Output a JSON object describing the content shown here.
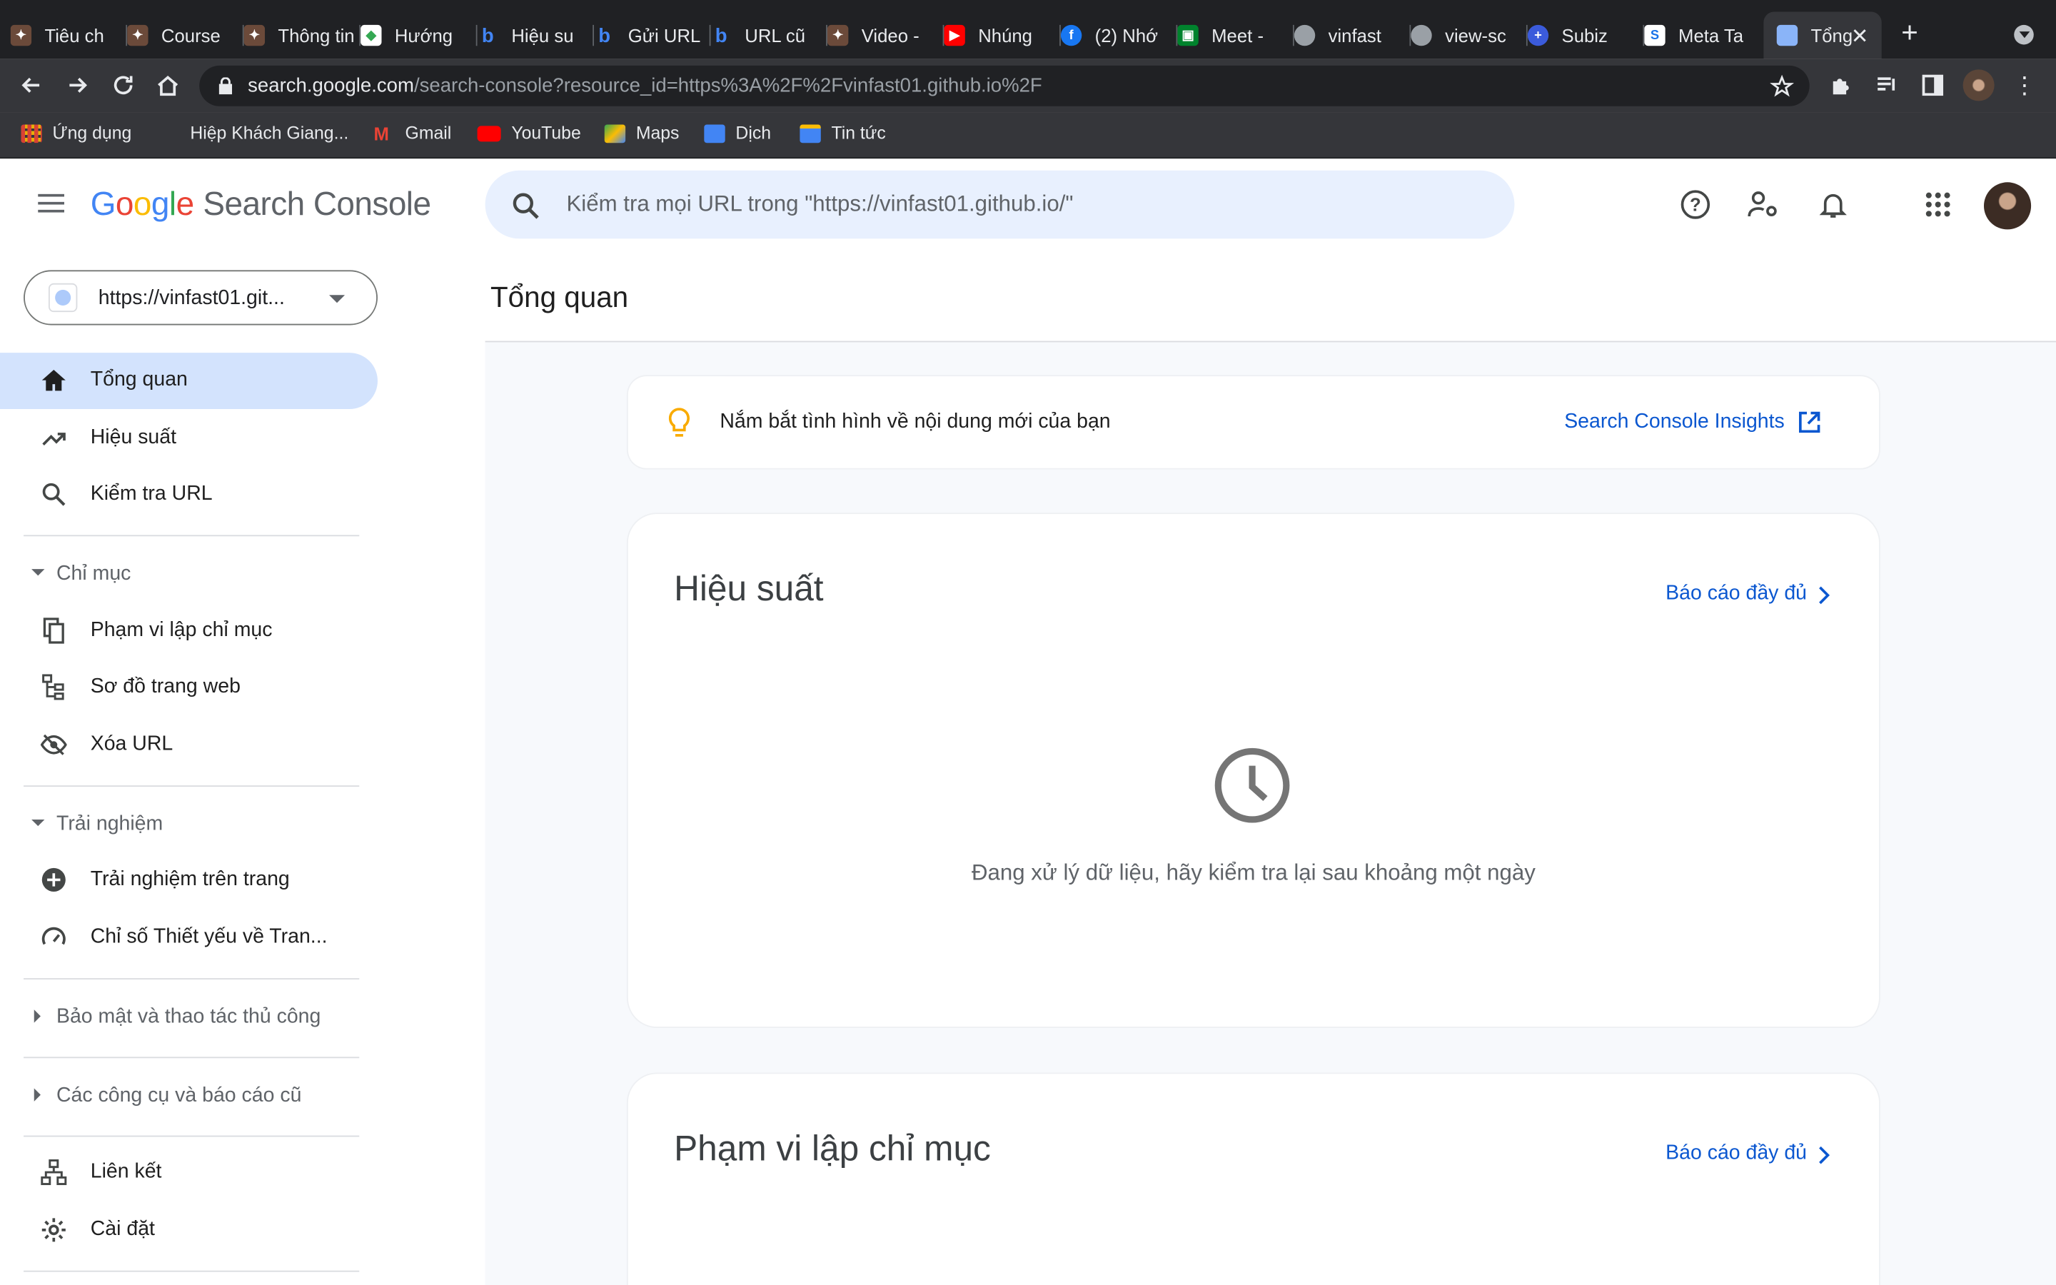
{
  "browser": {
    "tabs": [
      {
        "title": "Tiêu ch",
        "icon": "logo-icon"
      },
      {
        "title": "Course",
        "icon": "logo-icon"
      },
      {
        "title": "Thông tin",
        "icon": "logo-icon"
      },
      {
        "title": "Hướng",
        "icon": "dev-icon"
      },
      {
        "title": "Hiệu su",
        "icon": "bing-icon"
      },
      {
        "title": "Gửi URL",
        "icon": "bing-icon"
      },
      {
        "title": "URL cũ",
        "icon": "bing-icon"
      },
      {
        "title": "Video -",
        "icon": "logo-icon"
      },
      {
        "title": "Nhúng",
        "icon": "youtube-icon"
      },
      {
        "title": "(2) Nhớ",
        "icon": "facebook-icon"
      },
      {
        "title": "Meet -",
        "icon": "meet-icon"
      },
      {
        "title": "vinfast",
        "icon": "globe-icon"
      },
      {
        "title": "view-sc",
        "icon": "globe-icon"
      },
      {
        "title": "Subiz",
        "icon": "subiz-icon"
      },
      {
        "title": "Meta Ta",
        "icon": "meta-icon"
      },
      {
        "title": "Tổng",
        "icon": "search-console-icon"
      }
    ],
    "url_host": "search.google.com",
    "url_path": "/search-console?resource_id=https%3A%2F%2Fvinfast01.github.io%2F",
    "bookmarks": [
      {
        "label": "Ứng dụng",
        "color": "#8ab4f8"
      },
      {
        "label": "Hiệp Khách Giang...",
        "color": ""
      },
      {
        "label": "Gmail",
        "color": "#ea4335"
      },
      {
        "label": "YouTube",
        "color": "#ff0000"
      },
      {
        "label": "Maps",
        "color": "#34a853"
      },
      {
        "label": "Dịch",
        "color": "#4285f4"
      },
      {
        "label": "Tin tức",
        "color": "#4285f4"
      }
    ]
  },
  "app": {
    "logo_google": "Google",
    "logo_product": "Search Console",
    "search_placeholder": "Kiểm tra mọi URL trong \"https://vinfast01.github.io/\"",
    "property": "https://vinfast01.git..."
  },
  "sidebar": {
    "items": [
      {
        "label": "Tổng quan",
        "icon": "home-icon",
        "active": true
      },
      {
        "label": "Hiệu suất",
        "icon": "trending-up-icon"
      },
      {
        "label": "Kiểm tra URL",
        "icon": "search-icon"
      }
    ],
    "index_section": "Chỉ mục",
    "index_items": [
      {
        "label": "Phạm vi lập chỉ mục",
        "icon": "file-copy-icon"
      },
      {
        "label": "Sơ đồ trang web",
        "icon": "sitemap-icon"
      },
      {
        "label": "Xóa URL",
        "icon": "visibility-off-icon"
      }
    ],
    "experience_section": "Trải nghiệm",
    "experience_items": [
      {
        "label": "Trải nghiệm trên trang",
        "icon": "add-circle-icon"
      },
      {
        "label": "Chỉ số Thiết yếu về Tran...",
        "icon": "speed-icon"
      }
    ],
    "security_section": "Bảo mật và thao tác thủ công",
    "legacy_section": "Các công cụ và báo cáo cũ",
    "bottom_items": [
      {
        "label": "Liên kết",
        "icon": "links-icon"
      },
      {
        "label": "Cài đặt",
        "icon": "settings-icon"
      }
    ]
  },
  "main": {
    "title": "Tổng quan",
    "insight_text": "Nắm bắt tình hình về nội dung mới của bạn",
    "insight_link": "Search Console Insights",
    "performance_title": "Hiệu suất",
    "full_report": "Báo cáo đầy đủ",
    "pending_text": "Đang xử lý dữ liệu, hãy kiểm tra lại sau khoảng một ngày",
    "index_title": "Phạm vi lập chỉ mục"
  },
  "colors": {
    "accent": "#0b57d0",
    "active_nav": "#d3e3fd",
    "search_bg": "#e8f0fe"
  }
}
